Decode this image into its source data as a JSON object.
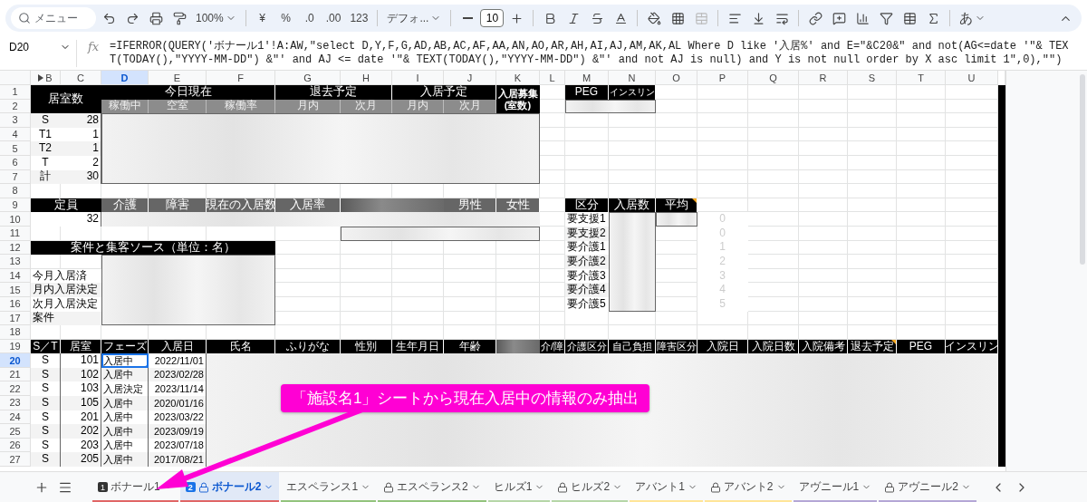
{
  "toolbar": {
    "search_placeholder": "メニュー",
    "zoom": "100%",
    "currency": "¥",
    "percent": "%",
    "decimal_decrease": ".0",
    "decimal_increase": ".00",
    "number_format": "123",
    "font": "デフォ...",
    "font_size": "10",
    "input_mode": "あ"
  },
  "formula_bar": {
    "cell": "D20",
    "fx": "fx",
    "formula": "=IFERROR(QUERY('ボナール1'!A:AW,\"select D,Y,F,G,AD,AB,AC,AF,AA,AN,AO,AR,AH,AI,AJ,AM,AK,AL Where D like '入居%' and E=\"&C20&\" and not(AG<=date '\"& TEXT(TODAY(),\"YYYY-MM-DD\") &\"' and AJ <= date '\"& TEXT(TODAY(),\"YYYY-MM-DD\") &\"' and not AJ is null) and Y is not null order by X asc limit 1\",0),\"\")"
  },
  "columns": [
    {
      "label": "B",
      "selected": false
    },
    {
      "label": "C",
      "selected": false
    },
    {
      "label": "D",
      "selected": true
    },
    {
      "label": "E",
      "selected": false
    },
    {
      "label": "F",
      "selected": false
    },
    {
      "label": "G",
      "selected": false
    },
    {
      "label": "H",
      "selected": false
    },
    {
      "label": "I",
      "selected": false
    },
    {
      "label": "J",
      "selected": false
    },
    {
      "label": "K",
      "selected": false
    },
    {
      "label": "L",
      "selected": false
    },
    {
      "label": "M",
      "selected": false
    },
    {
      "label": "N",
      "selected": false
    },
    {
      "label": "O",
      "selected": false
    },
    {
      "label": "P",
      "selected": false
    },
    {
      "label": "Q",
      "selected": false
    },
    {
      "label": "R",
      "selected": false
    },
    {
      "label": "S",
      "selected": false
    },
    {
      "label": "T",
      "selected": false
    },
    {
      "label": "U",
      "selected": false
    }
  ],
  "rows": [
    {
      "label": "1",
      "selected": false
    },
    {
      "label": "2",
      "selected": false
    },
    {
      "label": "3",
      "selected": false
    },
    {
      "label": "4",
      "selected": false
    },
    {
      "label": "5",
      "selected": false
    },
    {
      "label": "6",
      "selected": false
    },
    {
      "label": "7",
      "selected": false
    },
    {
      "label": "8",
      "selected": false
    },
    {
      "label": "9",
      "selected": false
    },
    {
      "label": "10",
      "selected": false
    },
    {
      "label": "11",
      "selected": false
    },
    {
      "label": "12",
      "selected": false
    },
    {
      "label": "13",
      "selected": false
    },
    {
      "label": "14",
      "selected": false
    },
    {
      "label": "15",
      "selected": false
    },
    {
      "label": "16",
      "selected": false
    },
    {
      "label": "17",
      "selected": false
    },
    {
      "label": "18",
      "selected": false
    },
    {
      "label": "19",
      "selected": false
    },
    {
      "label": "20",
      "selected": true
    },
    {
      "label": "21",
      "selected": false
    },
    {
      "label": "22",
      "selected": false
    },
    {
      "label": "23",
      "selected": false
    },
    {
      "label": "24",
      "selected": false
    },
    {
      "label": "25",
      "selected": false
    },
    {
      "label": "26",
      "selected": false
    },
    {
      "label": "27",
      "selected": false
    }
  ],
  "room_summary": {
    "title": "居室数",
    "rows": [
      {
        "type": "S",
        "count": "28"
      },
      {
        "type": "T1",
        "count": "1"
      },
      {
        "type": "T2",
        "count": "1"
      },
      {
        "type": "T",
        "count": "2"
      },
      {
        "type": "計",
        "count": "30"
      }
    ]
  },
  "occupancy": {
    "groups": [
      {
        "title": "今日現在",
        "subs": [
          "稼働中",
          "空室",
          "稼働率"
        ]
      },
      {
        "title": "退去予定",
        "subs": [
          "月内",
          "次月"
        ]
      },
      {
        "title": "入居予定",
        "subs": [
          "月内",
          "次月"
        ]
      }
    ],
    "recruit": [
      "入居募集",
      "(室数)"
    ]
  },
  "medical": {
    "headers": [
      "PEG",
      "インスリン"
    ]
  },
  "capacity": {
    "title": "定員",
    "value": "32",
    "headers": [
      "介護",
      "障害",
      "現在の入居数",
      "入居率"
    ],
    "headers_right": [
      "男性",
      "女性"
    ]
  },
  "sources": {
    "title": "案件と集客ソース（単位：名）",
    "rows": [
      "今月入居済",
      "月内入居決定",
      "次月入居決定",
      "案件"
    ]
  },
  "care_levels": {
    "headers": [
      {
        "label": "区分",
        "note": false
      },
      {
        "label": "入居数",
        "note": false
      },
      {
        "label": "平均",
        "note": true
      }
    ],
    "rows": [
      {
        "label": "要支援1",
        "index": "0"
      },
      {
        "label": "要支援2",
        "index": "0"
      },
      {
        "label": "要介護1",
        "index": "1"
      },
      {
        "label": "要介護2",
        "index": "2"
      },
      {
        "label": "要介護3",
        "index": "3"
      },
      {
        "label": "要介護4",
        "index": "4"
      },
      {
        "label": "要介護5",
        "index": "5"
      }
    ]
  },
  "residents": {
    "columns": [
      {
        "label": "S／T",
        "note": false
      },
      {
        "label": "居室",
        "note": false
      },
      {
        "label": "フェーズ",
        "note": false
      },
      {
        "label": "入居日",
        "note": false
      },
      {
        "label": "氏名",
        "note": false
      },
      {
        "label": "ふりがな",
        "note": false
      },
      {
        "label": "性別",
        "note": false
      },
      {
        "label": "生年月日",
        "note": false
      },
      {
        "label": "年齢",
        "note": false
      },
      {
        "label": "介/障",
        "note": false
      },
      {
        "label": "介護区分",
        "note": false
      },
      {
        "label": "自己負担",
        "note": false
      },
      {
        "label": "障害区分",
        "note": false
      },
      {
        "label": "入院日",
        "note": false
      },
      {
        "label": "入院日数",
        "note": false
      },
      {
        "label": "入院備考",
        "note": false
      },
      {
        "label": "退去予定",
        "note": true
      },
      {
        "label": "PEG",
        "note": false
      },
      {
        "label": "インスリン",
        "note": false
      }
    ],
    "rows": [
      {
        "type": "S",
        "room": "101",
        "phase": "入居中",
        "date": "2022/11/01",
        "selected": true
      },
      {
        "type": "S",
        "room": "102",
        "phase": "入居中",
        "date": "2023/02/28",
        "selected": false
      },
      {
        "type": "S",
        "room": "103",
        "phase": "入居決定",
        "date": "2023/11/14",
        "selected": false
      },
      {
        "type": "S",
        "room": "105",
        "phase": "入居中",
        "date": "2020/01/16",
        "selected": false
      },
      {
        "type": "S",
        "room": "201",
        "phase": "入居中",
        "date": "2023/03/22",
        "selected": false
      },
      {
        "type": "S",
        "room": "202",
        "phase": "入居中",
        "date": "2023/09/19",
        "selected": false
      },
      {
        "type": "S",
        "room": "203",
        "phase": "入居中",
        "date": "2023/07/18",
        "selected": false
      },
      {
        "type": "S",
        "room": "205",
        "phase": "入居中",
        "date": "2017/08/21",
        "selected": false
      }
    ]
  },
  "callout": "「施設名1」シートから現在入居中の情報のみ抽出",
  "sheet_tabs": [
    {
      "label": "ボナール1",
      "badge": "1",
      "locked": false,
      "selected": false,
      "color": "#e06666"
    },
    {
      "label": "ボナール2",
      "badge": "2",
      "locked": true,
      "selected": true,
      "color": "#e06666"
    },
    {
      "label": "エスペランス1",
      "locked": false,
      "selected": false,
      "color": "#93c47d"
    },
    {
      "label": "エスペランス2",
      "locked": true,
      "selected": false,
      "color": "#93c47d"
    },
    {
      "label": "ヒルズ1",
      "locked": false,
      "selected": false,
      "color": "#b6d7a8"
    },
    {
      "label": "ヒルズ2",
      "locked": true,
      "selected": false,
      "color": "#b6d7a8"
    },
    {
      "label": "アバント1",
      "locked": false,
      "selected": false,
      "color": "#ffe599"
    },
    {
      "label": "アバント2",
      "locked": true,
      "selected": false,
      "color": "#ffe599"
    },
    {
      "label": "アヴニール1",
      "locked": false,
      "selected": false,
      "color": "#b4a7d6"
    },
    {
      "label": "アヴニール2",
      "locked": true,
      "selected": false,
      "color": "#b4a7d6"
    }
  ]
}
